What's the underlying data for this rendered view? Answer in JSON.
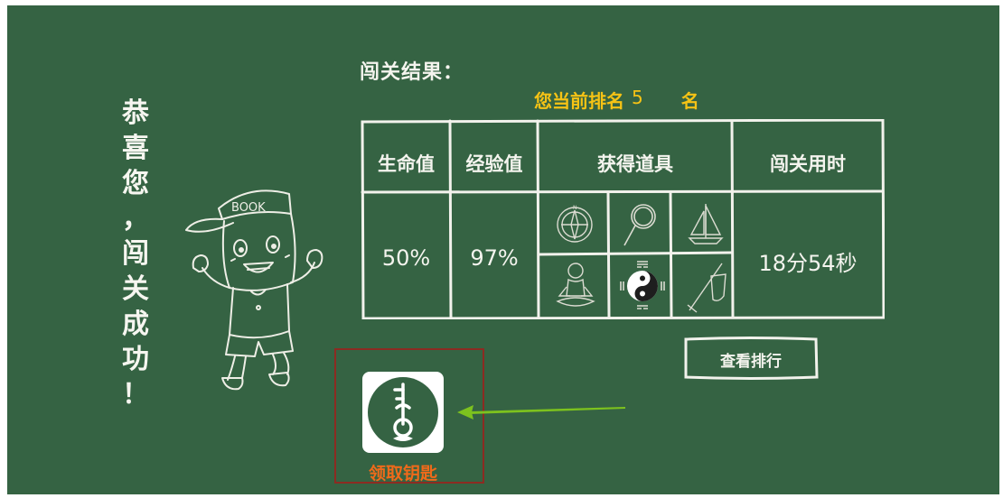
{
  "congrats": {
    "chars": [
      "恭",
      "喜",
      "您",
      "，",
      "闯",
      "关",
      "成",
      "功",
      "！"
    ]
  },
  "character": {
    "cap_text": "BOOK"
  },
  "results": {
    "title": "闯关结果：",
    "rank_prefix": "您当前排名",
    "rank_value": "5",
    "rank_suffix": "名"
  },
  "table": {
    "headers": {
      "hp": "生命值",
      "exp": "经验值",
      "items": "获得道具",
      "time": "闯关用时"
    },
    "values": {
      "hp": "50%",
      "exp": "97%",
      "time": "18分54秒"
    },
    "items": [
      {
        "icon": "compass-icon"
      },
      {
        "icon": "magnifier-icon"
      },
      {
        "icon": "sailboat-icon"
      },
      {
        "icon": "meditating-figure-icon"
      },
      {
        "icon": "yin-yang-bagua-icon"
      },
      {
        "icon": "sword-and-shield-icon"
      }
    ]
  },
  "buttons": {
    "view_rank": "查看排行",
    "claim_key": "领取钥匙"
  },
  "colors": {
    "board": "#356343",
    "chalk": "#f4f4ee",
    "rank_yellow": "#f6c315",
    "key_orange": "#f06a1a",
    "highlight_border": "#8c2b22",
    "arrow_green": "#7dc21e"
  }
}
